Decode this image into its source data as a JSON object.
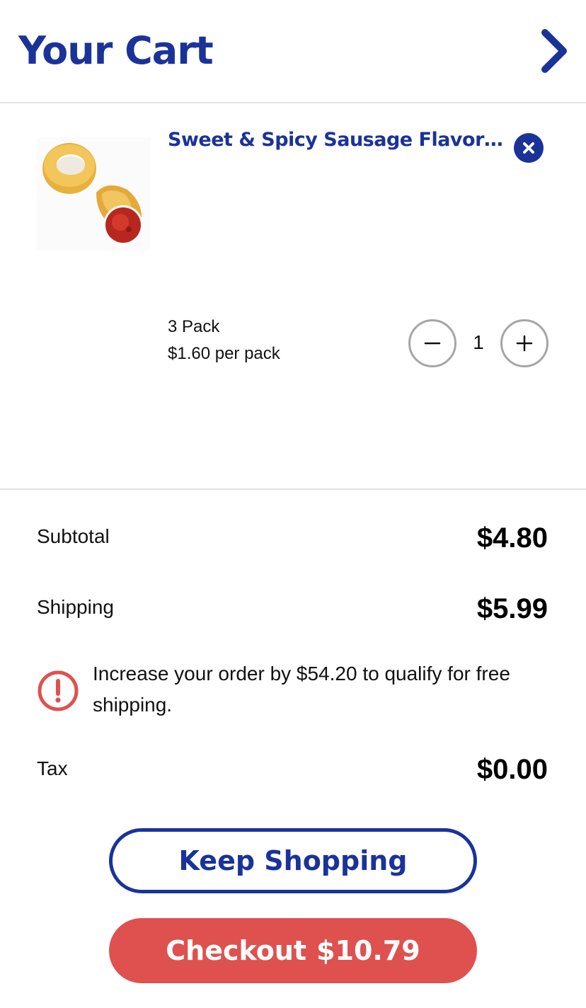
{
  "header": {
    "title": "Your Cart",
    "close_icon": "chevron-right-icon"
  },
  "cart": {
    "items": [
      {
        "name": "Sweet & Spicy Sausage Flavore...",
        "pack": "3 Pack",
        "price_per_pack": "$1.60 per pack",
        "quantity": "1",
        "remove_icon": "close-icon",
        "decrement_icon": "minus-icon",
        "increment_icon": "plus-icon",
        "image": "product-thumbnail-onion-rings-with-sauce"
      }
    ]
  },
  "summary": {
    "subtotal_label": "Subtotal",
    "subtotal_value": "$4.80",
    "shipping_label": "Shipping",
    "shipping_value": "$5.99",
    "notice_icon": "exclamation-circle-icon",
    "notice_text": "Increase your order by $54.20 to qualify for free shipping.",
    "tax_label": "Tax",
    "tax_value": "$0.00"
  },
  "actions": {
    "keep_shopping_label": "Keep Shopping",
    "checkout_label": "Checkout",
    "checkout_total": "$10.79"
  },
  "colors": {
    "brand_blue": "#1a3399",
    "accent_red": "#de514f",
    "stepper_border": "#a6a6a6",
    "divider": "#e2e2e2"
  }
}
